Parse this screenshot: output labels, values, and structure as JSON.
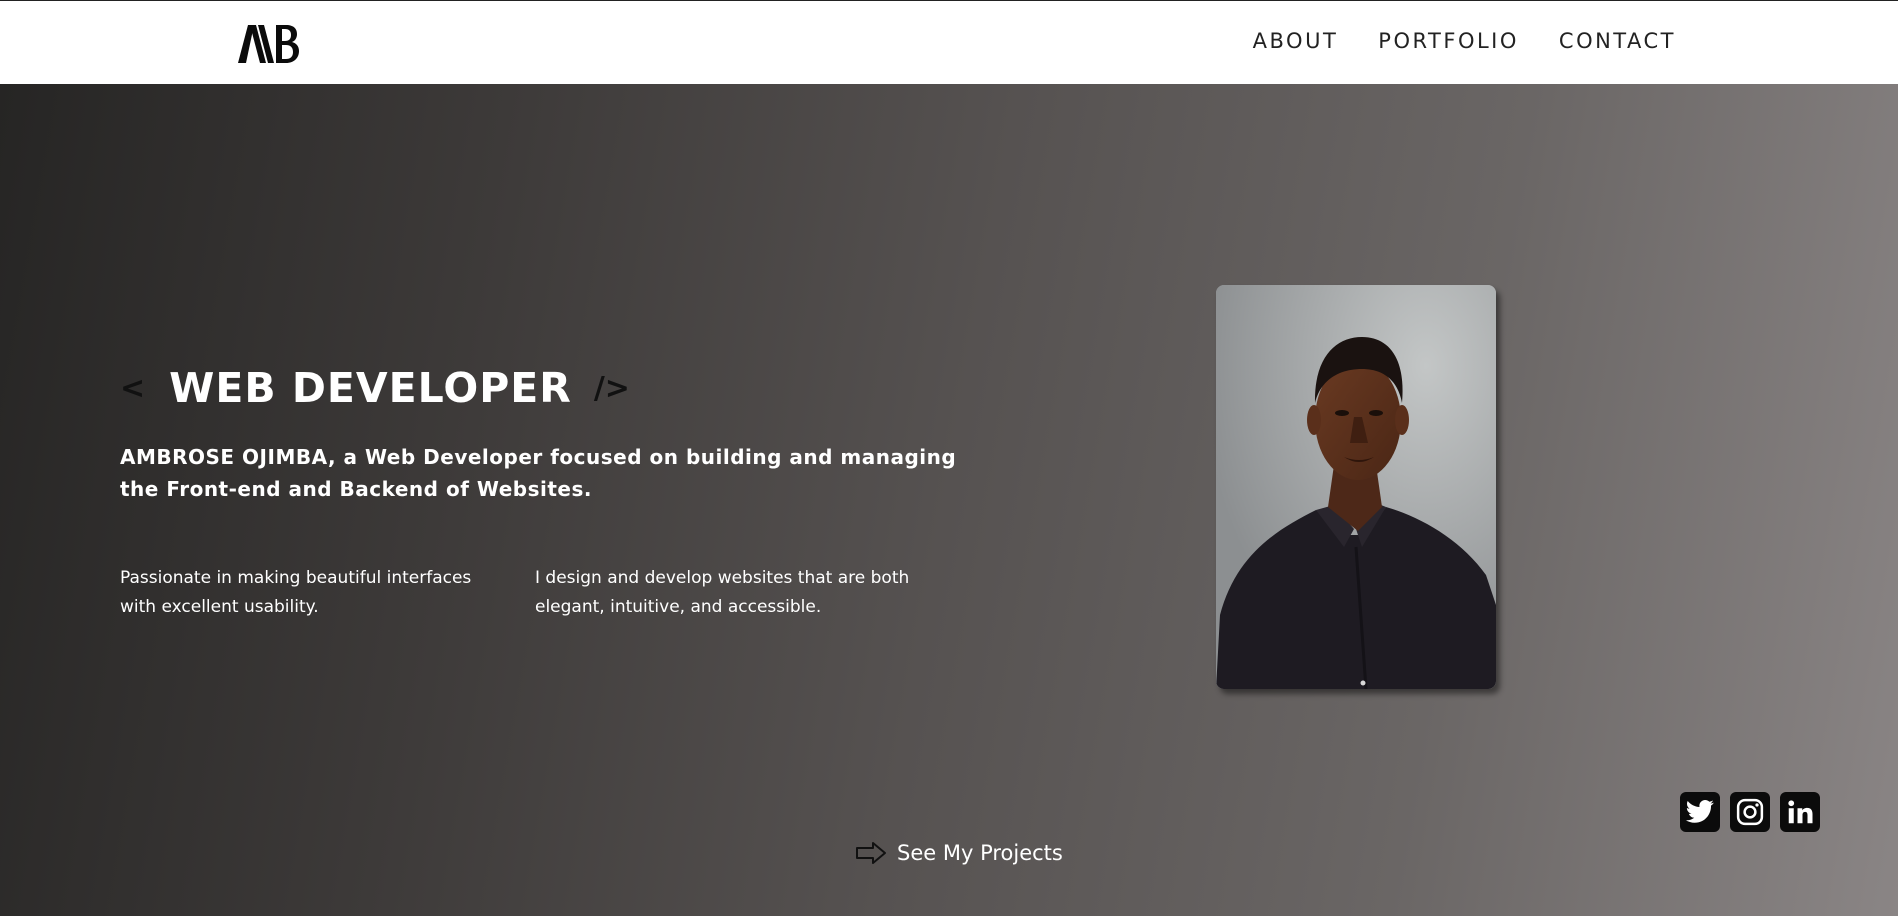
{
  "brand": {
    "logo_text": "AB"
  },
  "nav": {
    "items": [
      {
        "label": "ABOUT"
      },
      {
        "label": "PORTFOLIO"
      },
      {
        "label": "CONTACT"
      }
    ]
  },
  "hero": {
    "bracket_open": "<",
    "title": "WEB DEVELOPER",
    "bracket_close": "/>",
    "intro": "AMBROSE OJIMBA, a Web Developer focused on building and managing the Front-end and Backend of Websites.",
    "blurb_one": "Passionate in making beautiful interfaces with excellent usability.",
    "blurb_two": "I design and develop websites that are both elegant, intuitive, and accessible.",
    "cta_label": "See My Projects"
  },
  "socials": [
    {
      "icon": "twitter-icon"
    },
    {
      "icon": "instagram-icon"
    },
    {
      "icon": "linkedin-icon"
    }
  ],
  "colors": {
    "header_bg": "#ffffff",
    "hero_gradient_start": "#262524",
    "hero_gradient_end": "#8a8585",
    "text_light": "#ffffff",
    "social_bg": "#0b0b0b"
  }
}
